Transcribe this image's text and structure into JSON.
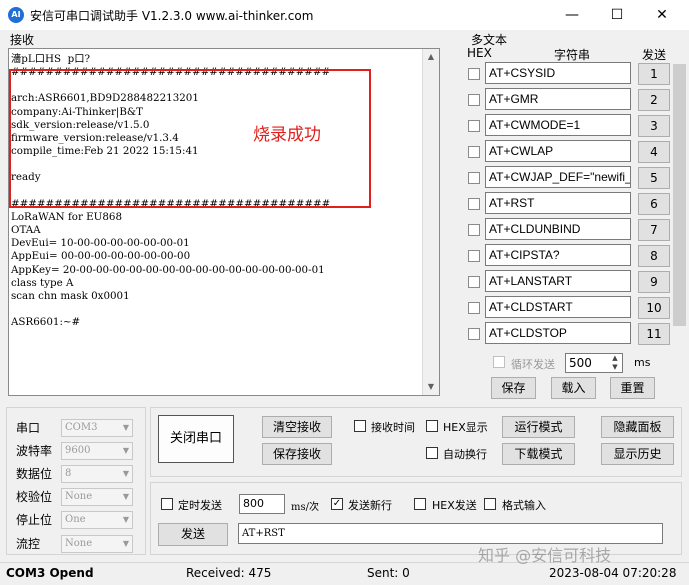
{
  "window": {
    "title": "安信可串口调试助手 V1.2.3.0     www.ai-thinker.com",
    "logo_text": "AI",
    "minimize_glyph": "—",
    "maximize_glyph": "☐",
    "close_glyph": "✕"
  },
  "receive": {
    "label": "接收",
    "text": "濇pL口HS  p口?\n#####################################\n\narch:ASR6601,BD9D288482213201\ncompany:Ai-Thinker|B&T\nsdk_version:release/v1.5.0\nfirmware_version:release/v1.3.4\ncompile_time:Feb 21 2022 15:15:41\n\nready\n\n#####################################\nLoRaWAN for EU868\nOTAA\nDevEui= 10-00-00-00-00-00-00-01\nAppEui= 00-00-00-00-00-00-00-00\nAppKey= 20-00-00-00-00-00-00-00-00-00-00-00-00-00-00-01\nclass type A\nscan chn mask 0x0001\n\nASR6601:~#",
    "annotation": "烧录成功",
    "annotation_color": "#e0201c"
  },
  "multi_text": {
    "label": "多文本",
    "hex_header": "HEX",
    "string_header": "字符串",
    "send_header": "发送",
    "items": [
      {
        "text": "AT+CSYSID",
        "button": "1"
      },
      {
        "text": "AT+GMR",
        "button": "2"
      },
      {
        "text": "AT+CWMODE=1",
        "button": "3"
      },
      {
        "text": "AT+CWLAP",
        "button": "4"
      },
      {
        "text": "AT+CWJAP_DEF=\"newifi_",
        "button": "5"
      },
      {
        "text": "AT+RST",
        "button": "6"
      },
      {
        "text": "AT+CLDUNBIND",
        "button": "7"
      },
      {
        "text": "AT+CIPSTA?",
        "button": "8"
      },
      {
        "text": "AT+LANSTART",
        "button": "9"
      },
      {
        "text": "AT+CLDSTART",
        "button": "10"
      },
      {
        "text": "AT+CLDSTOP",
        "button": "11"
      }
    ],
    "loop_send_label": "循环发送",
    "loop_interval": "500",
    "loop_unit": "ms",
    "save_label": "保存",
    "load_label": "载入",
    "reset_label": "重置"
  },
  "settings": {
    "port_label": "串口",
    "port_value": "COM3",
    "baud_label": "波特率",
    "baud_value": "9600",
    "databits_label": "数据位",
    "databits_value": "8",
    "parity_label": "校验位",
    "parity_value": "None",
    "stopbits_label": "停止位",
    "stopbits_value": "One",
    "flow_label": "流控",
    "flow_value": "None"
  },
  "controls": {
    "close_port": "关闭串口",
    "clear_receive": "清空接收",
    "save_receive": "保存接收",
    "receive_time": "接收时间",
    "hex_display": "HEX显示",
    "auto_wrap": "自动换行",
    "run_mode": "运行模式",
    "download_mode": "下载模式",
    "hide_panel": "隐藏面板",
    "show_history": "显示历史"
  },
  "send": {
    "timed_send": "定时发送",
    "interval": "800",
    "interval_unit": "ms/次",
    "newline_label": "发送新行",
    "hex_send": "HEX发送",
    "format_input": "格式输入",
    "send_button": "发送",
    "input_value": "AT+RST"
  },
  "status": {
    "port_status": "COM3 Opend",
    "received": "Received: 475",
    "sent": "Sent: 0",
    "time": "2023-08-04 07:20:28"
  },
  "watermark": "知乎 @安信可科技",
  "colors": {
    "accent_red": "#e0201c",
    "logo_blue": "#1f6fd6"
  }
}
